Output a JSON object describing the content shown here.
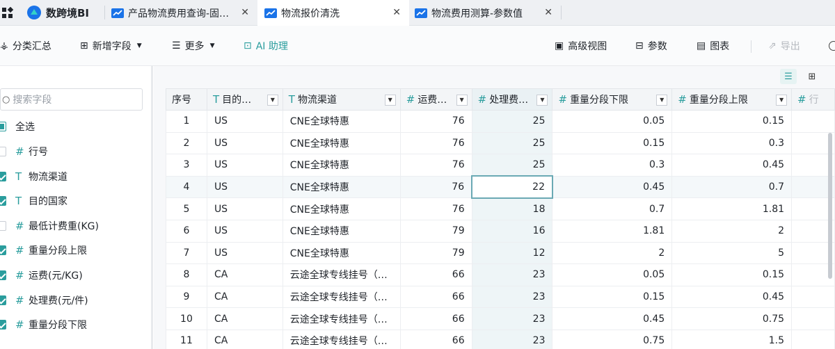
{
  "app": {
    "name": "数跨境BI"
  },
  "tabs": [
    {
      "label": "产品物流费用查询-固…",
      "active": false
    },
    {
      "label": "物流报价清洗",
      "active": true
    },
    {
      "label": "物流费用测算-参数值",
      "active": false
    }
  ],
  "toolbar": {
    "group_summary": "分类汇总",
    "add_field": "新增字段",
    "more": "更多",
    "ai_assistant": "AI 助理",
    "advanced_view": "高级视图",
    "params": "参数",
    "chart": "图表",
    "export": "导出"
  },
  "left": {
    "search_placeholder": "搜索字段",
    "select_all": "全选",
    "fields": [
      {
        "type": "#",
        "name": "行号",
        "checked": false
      },
      {
        "type": "T",
        "name": "物流渠道",
        "checked": true
      },
      {
        "type": "T",
        "name": "目的国家",
        "checked": true
      },
      {
        "type": "#",
        "name": "最低计费重(KG)",
        "checked": false
      },
      {
        "type": "#",
        "name": "重量分段上限",
        "checked": true
      },
      {
        "type": "#",
        "name": "运费(元/KG)",
        "checked": true
      },
      {
        "type": "#",
        "name": "处理费(元/件)",
        "checked": true
      },
      {
        "type": "#",
        "name": "重量分段下限",
        "checked": true
      }
    ]
  },
  "table": {
    "columns": [
      {
        "type": "",
        "label": "序号"
      },
      {
        "type": "T",
        "label": "目的…"
      },
      {
        "type": "T",
        "label": "物流渠道"
      },
      {
        "type": "#",
        "label": "运费…"
      },
      {
        "type": "#",
        "label": "处理费…"
      },
      {
        "type": "#",
        "label": "重量分段下限"
      },
      {
        "type": "#",
        "label": "重量分段上限"
      },
      {
        "type": "#",
        "label": "行"
      }
    ],
    "rows": [
      [
        "1",
        "US",
        "CNE全球特惠",
        "76",
        "25",
        "0.05",
        "0.15"
      ],
      [
        "2",
        "US",
        "CNE全球特惠",
        "76",
        "25",
        "0.15",
        "0.3"
      ],
      [
        "3",
        "US",
        "CNE全球特惠",
        "76",
        "25",
        "0.3",
        "0.45"
      ],
      [
        "4",
        "US",
        "CNE全球特惠",
        "76",
        "22",
        "0.45",
        "0.7"
      ],
      [
        "5",
        "US",
        "CNE全球特惠",
        "76",
        "18",
        "0.7",
        "1.81"
      ],
      [
        "6",
        "US",
        "CNE全球特惠",
        "79",
        "16",
        "1.81",
        "2"
      ],
      [
        "7",
        "US",
        "CNE全球特惠",
        "79",
        "12",
        "2",
        "5"
      ],
      [
        "8",
        "CA",
        "云途全球专线挂号（…",
        "66",
        "23",
        "0.05",
        "0.15"
      ],
      [
        "9",
        "CA",
        "云途全球专线挂号（…",
        "66",
        "23",
        "0.15",
        "0.45"
      ],
      [
        "10",
        "CA",
        "云途全球专线挂号（…",
        "66",
        "23",
        "0.45",
        "0.75"
      ],
      [
        "11",
        "CA",
        "云途全球专线挂号（…",
        "66",
        "23",
        "0.75",
        "1.5"
      ]
    ],
    "selected_row": 3
  },
  "colors": {
    "accent": "#2a9d9d",
    "brand": "#1a73e8"
  }
}
